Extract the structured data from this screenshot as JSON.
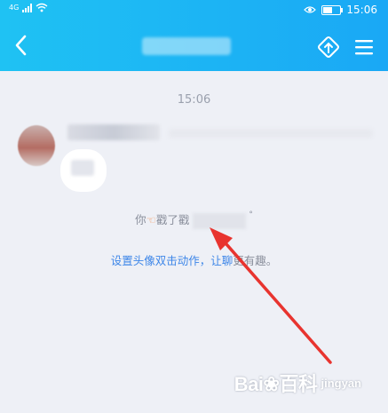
{
  "status_bar": {
    "time": "15:06",
    "network_label": "4G",
    "battery_level": 0.55,
    "icons": [
      "signal-icon",
      "wifi-icon",
      "eye-icon",
      "battery-icon"
    ]
  },
  "nav_bar": {
    "back_icon": "chevron-left-icon",
    "poke_icon": "poke-hand-icon",
    "menu_icon": "hamburger-menu-icon",
    "accent_color": "#1fb4f4"
  },
  "chat": {
    "timestamp": "15:06",
    "poke_prefix": "你",
    "poke_verb": "戳了戳",
    "tip_link_text": "设置头像双击动作，让聊",
    "tip_rest_text": "更有趣。"
  },
  "watermark": {
    "logo_text": "Bai",
    "logo_suffix": "百科",
    "sub_text": "jingyan"
  },
  "colors": {
    "background": "#eef0f6",
    "link": "#3d86e8",
    "muted_text": "#8a8f9c",
    "annotation_arrow": "#e8342f"
  }
}
